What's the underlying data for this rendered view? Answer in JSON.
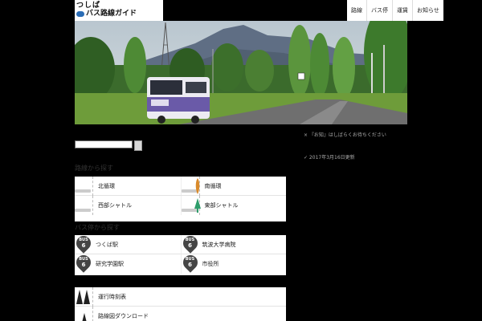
{
  "site": {
    "logo_line1": "つしぱ",
    "logo_line2": "バス路線ガイド"
  },
  "nav": [
    {
      "label": "路線"
    },
    {
      "label": "バス停"
    },
    {
      "label": "運賃"
    },
    {
      "label": "お知らせ"
    }
  ],
  "notices": [
    {
      "text": "× 『お知』はしばらくお待ちください"
    },
    {
      "text": "✓ 2017年3月16日更新"
    }
  ],
  "sections": {
    "s1_title": "路線から探す",
    "s2_title": "バス停から探す",
    "s1_items": [
      {
        "label": "北循環"
      },
      {
        "label": "南循環"
      },
      {
        "label": "西部シャトル"
      },
      {
        "label": "東部シャトル"
      }
    ],
    "s2_items": [
      {
        "label": "つくば駅",
        "badge": "BUS",
        "num": "6"
      },
      {
        "label": "筑波大学病院",
        "badge": "BUS",
        "num": "6"
      },
      {
        "label": "研究学園駅",
        "badge": "BUS",
        "num": "6"
      },
      {
        "label": "市役所",
        "badge": "BUS",
        "num": "6"
      }
    ],
    "s3_items": [
      {
        "label": "運行時刻表"
      },
      {
        "label": "路線図ダウンロード"
      }
    ]
  },
  "colors": {
    "accent": "#2a6cb5",
    "bus_purple": "#6a5aa8",
    "item_orange": "#d98a2b",
    "item_green": "#2e9d6b"
  }
}
